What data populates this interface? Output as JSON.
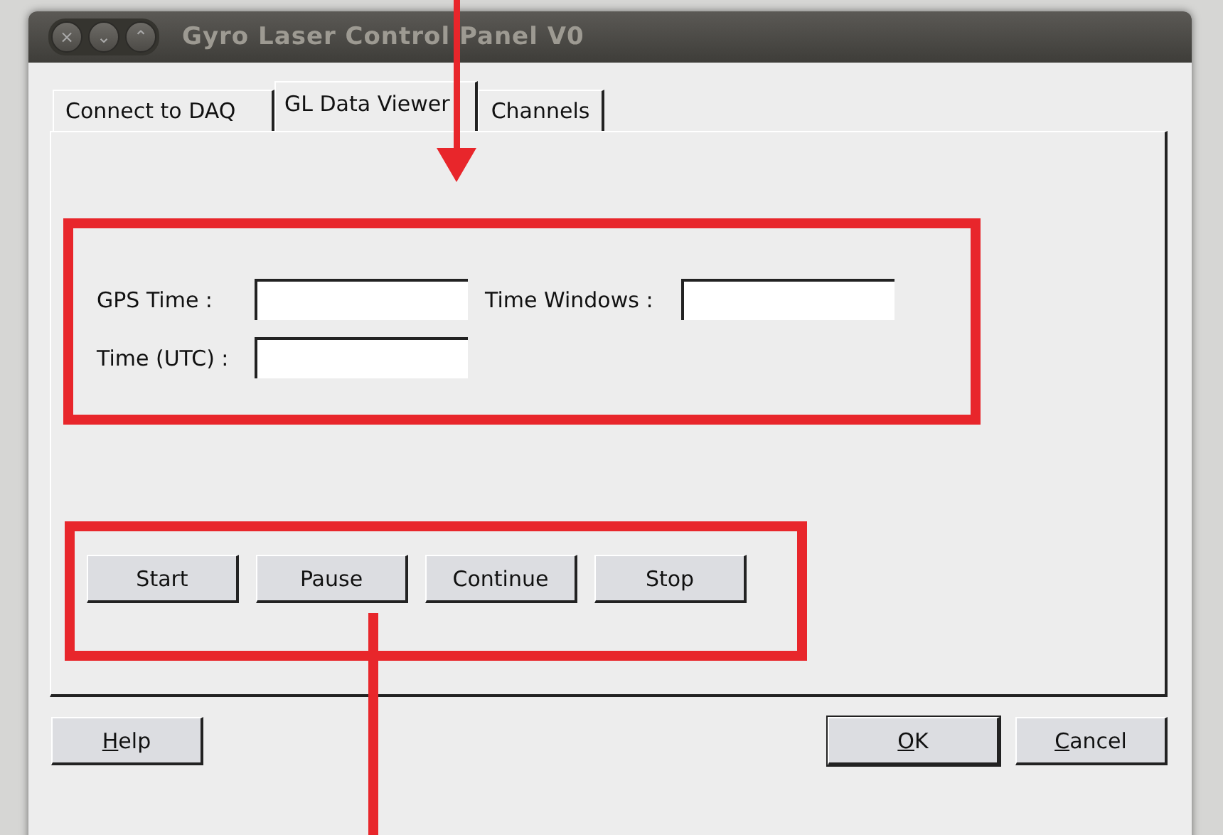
{
  "window": {
    "title": "Gyro Laser Control Panel V0",
    "controls": [
      "×",
      "⌄",
      "⌃"
    ]
  },
  "tabs": [
    {
      "label": "Connect to DAQ",
      "selected": false
    },
    {
      "label": "GL Data Viewer",
      "selected": true
    },
    {
      "label": "Channels",
      "selected": false
    }
  ],
  "fields": [
    {
      "label": "GPS Time :"
    },
    {
      "label": "Time Windows :"
    },
    {
      "label": "Time (UTC) :"
    }
  ],
  "actions": [
    "Start",
    "Pause",
    "Continue",
    "Stop"
  ],
  "footer_left": [
    {
      "label": "Help",
      "mnemonic": true,
      "default": false
    }
  ],
  "footer_right": [
    {
      "label": "OK",
      "mnemonic": true,
      "default": true
    },
    {
      "label": "Cancel",
      "mnemonic": true,
      "default": false
    }
  ]
}
